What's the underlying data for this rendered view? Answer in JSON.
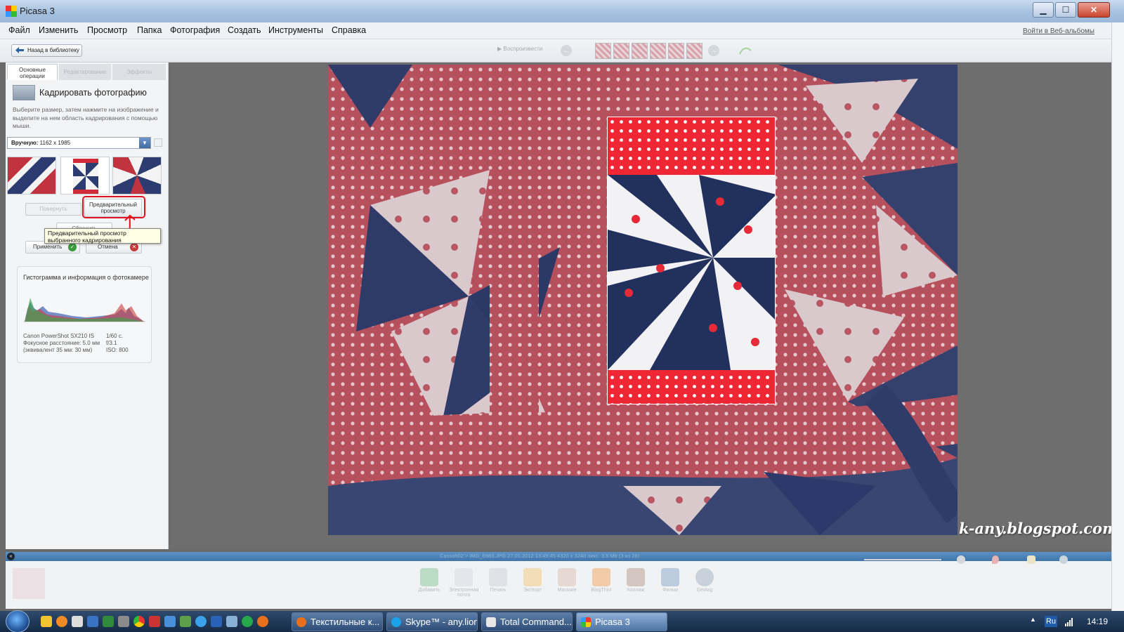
{
  "window": {
    "title": "Picasa 3",
    "min_label": "▁",
    "max_label": "☐",
    "close_label": "✕"
  },
  "menu": [
    "Файл",
    "Изменить",
    "Просмотр",
    "Папка",
    "Фотография",
    "Создать",
    "Инструменты",
    "Справка"
  ],
  "web_albums_link": "Войти в Веб-альбомы",
  "toolbar": {
    "back_label": "Назад в библиотеку",
    "play_label": "▶ Воспроизвести",
    "prev_icon": "←",
    "next_icon": "→"
  },
  "left_panel": {
    "tabs": [
      "Основные операции",
      "Редактирование",
      "Эффекты"
    ],
    "crop_title": "Кадрировать фотографию",
    "crop_desc": "Выберите размер, затем нажмите на изображение и выделите на нем область кадрирования с помощью мыши.",
    "aspect_label": "Вручную:",
    "aspect_value": "1162 x 1985",
    "select_arrow": "▼",
    "rotate_label": "Повернуть",
    "preview_label": "Предварительный просмотр",
    "reset_label": "Сбросить",
    "apply_label": "Применить",
    "cancel_label": "Отмена",
    "ok_glyph": "✓",
    "x_glyph": "✕",
    "tooltip": "Предварительный просмотр выбранного кадрирования",
    "histogram_title": "Гистограмма и информация о фотокамере",
    "camera": {
      "model": "Canon PowerShot SX210 IS",
      "focal": "Фокусное расстояние: 5.0 мм",
      "equiv": "(эквивалент 35 мм: 30 мм)",
      "shutter": "1/60 с.",
      "fstop": "f/3.1",
      "iso": "ISO: 800"
    }
  },
  "watermark": "k-any.blogspot.com",
  "statusbar": {
    "text": "Cassoh02 > IMG_6983.JPG    27.01.2012 13:49:45    4320 x 3240 пикс.    3.5 Mb    (3 из 28)",
    "collapse_glyph": "«"
  },
  "tray_buttons": [
    "Добавить",
    "Электронная почта",
    "Печать",
    "Экспорт",
    "Магазин",
    "BlogThis!",
    "Коллаж",
    "Фильм",
    "Geotag"
  ],
  "taskbar": {
    "tasks": [
      "Текстильные к...",
      "Skype™ - any.lion",
      "Total Command...",
      "Picasa 3"
    ],
    "lang": "Ru",
    "clock": "14:19",
    "tray_up": "▲"
  },
  "colors": {
    "accent": "#3f75a9",
    "fabric_red": "#d9303c",
    "fabric_navy": "#24305d",
    "highlight": "#e0141e"
  }
}
